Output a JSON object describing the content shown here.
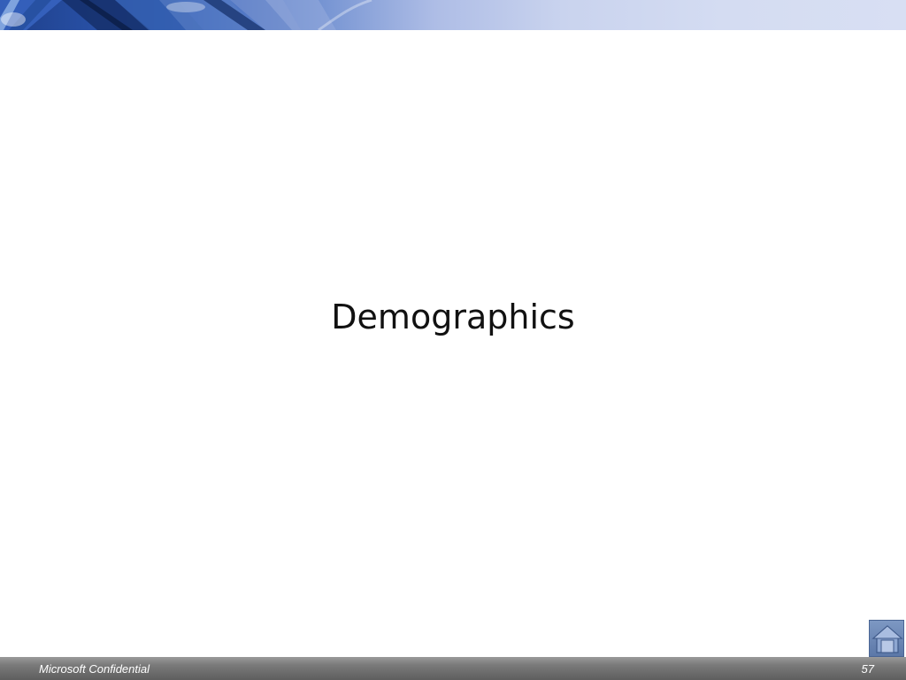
{
  "slide": {
    "title": "Demographics"
  },
  "footer": {
    "left_text": "Microsoft Confidential",
    "page_number": "57"
  },
  "controls": {
    "home_icon": "home-icon"
  },
  "colors": {
    "banner_dark": "#1e3f8a",
    "banner_light": "#d8dff3",
    "footer_bar": "#6e6e6e",
    "home_button": "#6b87b6"
  }
}
